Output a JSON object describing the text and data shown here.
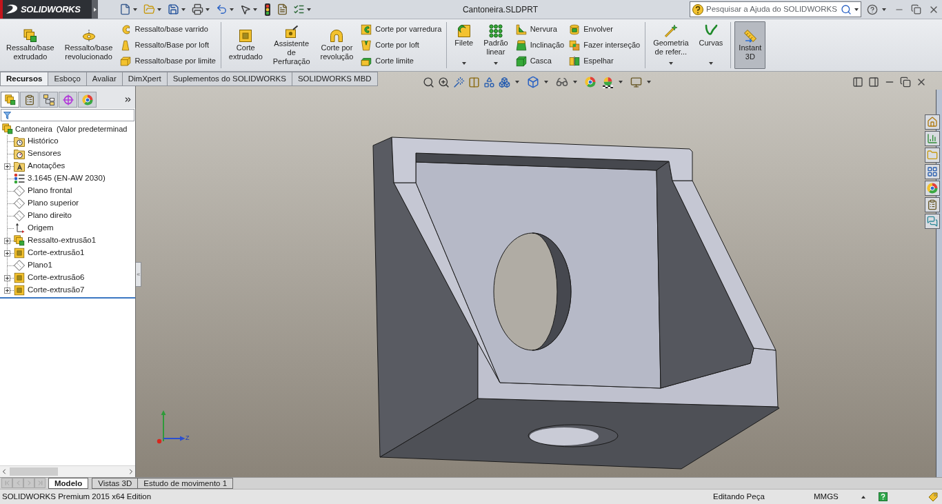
{
  "title_bar": {
    "logo": "SOLIDWORKS",
    "title": "Cantoneira.SLDPRT",
    "search": {
      "placeholder": "Pesquisar a Ajuda do SOLIDWORKS"
    }
  },
  "ribbon": {
    "groups": [
      {
        "items": [
          {
            "kind": "large",
            "label": "Ressalto/base\nextrudado",
            "dropdown": false,
            "pressed": false
          },
          {
            "kind": "large",
            "label": "Ressalto/base\nrevolucionado",
            "dropdown": false,
            "pressed": false
          },
          {
            "kind": "column",
            "items": [
              {
                "label": "Ressalto/base varrido"
              },
              {
                "label": "Ressalto/Base por loft"
              },
              {
                "label": "Ressalto/base por limite"
              }
            ]
          }
        ]
      },
      {
        "items": [
          {
            "kind": "large",
            "label": "Corte\nextrudado",
            "dropdown": false,
            "pressed": false
          },
          {
            "kind": "large",
            "label": "Assistente\nde\nPerfuração",
            "dropdown": false,
            "pressed": false
          },
          {
            "kind": "large",
            "label": "Corte por\nrevolução",
            "dropdown": false,
            "pressed": false
          },
          {
            "kind": "column",
            "items": [
              {
                "label": "Corte por varredura"
              },
              {
                "label": "Corte por loft"
              },
              {
                "label": "Corte limite"
              }
            ]
          }
        ]
      },
      {
        "items": [
          {
            "kind": "large",
            "label": "Filete",
            "dropdown": true,
            "pressed": false
          },
          {
            "kind": "large",
            "label": "Padrão\nlinear",
            "dropdown": true,
            "pressed": false
          },
          {
            "kind": "column",
            "items": [
              {
                "label": "Nervura"
              },
              {
                "label": "Inclinação"
              },
              {
                "label": "Casca"
              }
            ]
          },
          {
            "kind": "column",
            "items": [
              {
                "label": "Envolver"
              },
              {
                "label": "Fazer interseção"
              },
              {
                "label": "Espelhar"
              }
            ]
          }
        ]
      },
      {
        "items": [
          {
            "kind": "large",
            "label": "Geometria\nde refer...",
            "dropdown": true,
            "pressed": false
          },
          {
            "kind": "large",
            "label": "Curvas",
            "dropdown": true,
            "pressed": false
          }
        ]
      },
      {
        "items": [
          {
            "kind": "large",
            "label": "Instant\n3D",
            "dropdown": false,
            "pressed": true
          }
        ]
      }
    ]
  },
  "command_tabs": [
    {
      "label": "Recursos",
      "selected": true
    },
    {
      "label": "Esboço",
      "selected": false
    },
    {
      "label": "Avaliar",
      "selected": false
    },
    {
      "label": "DimXpert",
      "selected": false
    },
    {
      "label": "Suplementos do SOLIDWORKS",
      "selected": false
    },
    {
      "label": "SOLIDWORKS MBD",
      "selected": false
    }
  ],
  "feature_manager": {
    "panel_tabs": [
      {
        "selected": true
      },
      {
        "selected": false
      },
      {
        "selected": false
      },
      {
        "selected": false
      },
      {
        "selected": false
      }
    ],
    "tree": {
      "label": "Cantoneira  (Valor predeterminad",
      "kind": "part",
      "children": [
        {
          "label": "Histórico",
          "kind": "history",
          "expandable": false
        },
        {
          "label": "Sensores",
          "kind": "sensors",
          "expandable": false
        },
        {
          "label": "Anotações",
          "kind": "annotations",
          "expandable": true
        },
        {
          "label": "3.1645 (EN-AW 2030)",
          "kind": "material",
          "expandable": false
        },
        {
          "label": "Plano frontal",
          "kind": "plane",
          "expandable": false
        },
        {
          "label": "Plano superior",
          "kind": "plane",
          "expandable": false
        },
        {
          "label": "Plano direito",
          "kind": "plane",
          "expandable": false
        },
        {
          "label": "Origem",
          "kind": "origin",
          "expandable": false
        },
        {
          "label": "Ressalto-extrusão1",
          "kind": "boss",
          "expandable": true
        },
        {
          "label": "Corte-extrusão1",
          "kind": "cut",
          "expandable": true
        },
        {
          "label": "Plano1",
          "kind": "plane",
          "expandable": false
        },
        {
          "label": "Corte-extrusão6",
          "kind": "cut",
          "expandable": true
        },
        {
          "label": "Corte-extrusão7",
          "kind": "cut",
          "expandable": true
        }
      ]
    }
  },
  "viewport": {
    "triad": {
      "z_label": "Z"
    }
  },
  "model_tabs": [
    {
      "label": "Modelo",
      "selected": true
    },
    {
      "label": "Vistas 3D",
      "selected": false
    },
    {
      "label": "Estudo de movimento 1",
      "selected": false
    }
  ],
  "status_bar": {
    "product": "SOLIDWORKS Premium 2015 x64 Edition",
    "mode": "Editando Peça",
    "units": "MMGS"
  }
}
